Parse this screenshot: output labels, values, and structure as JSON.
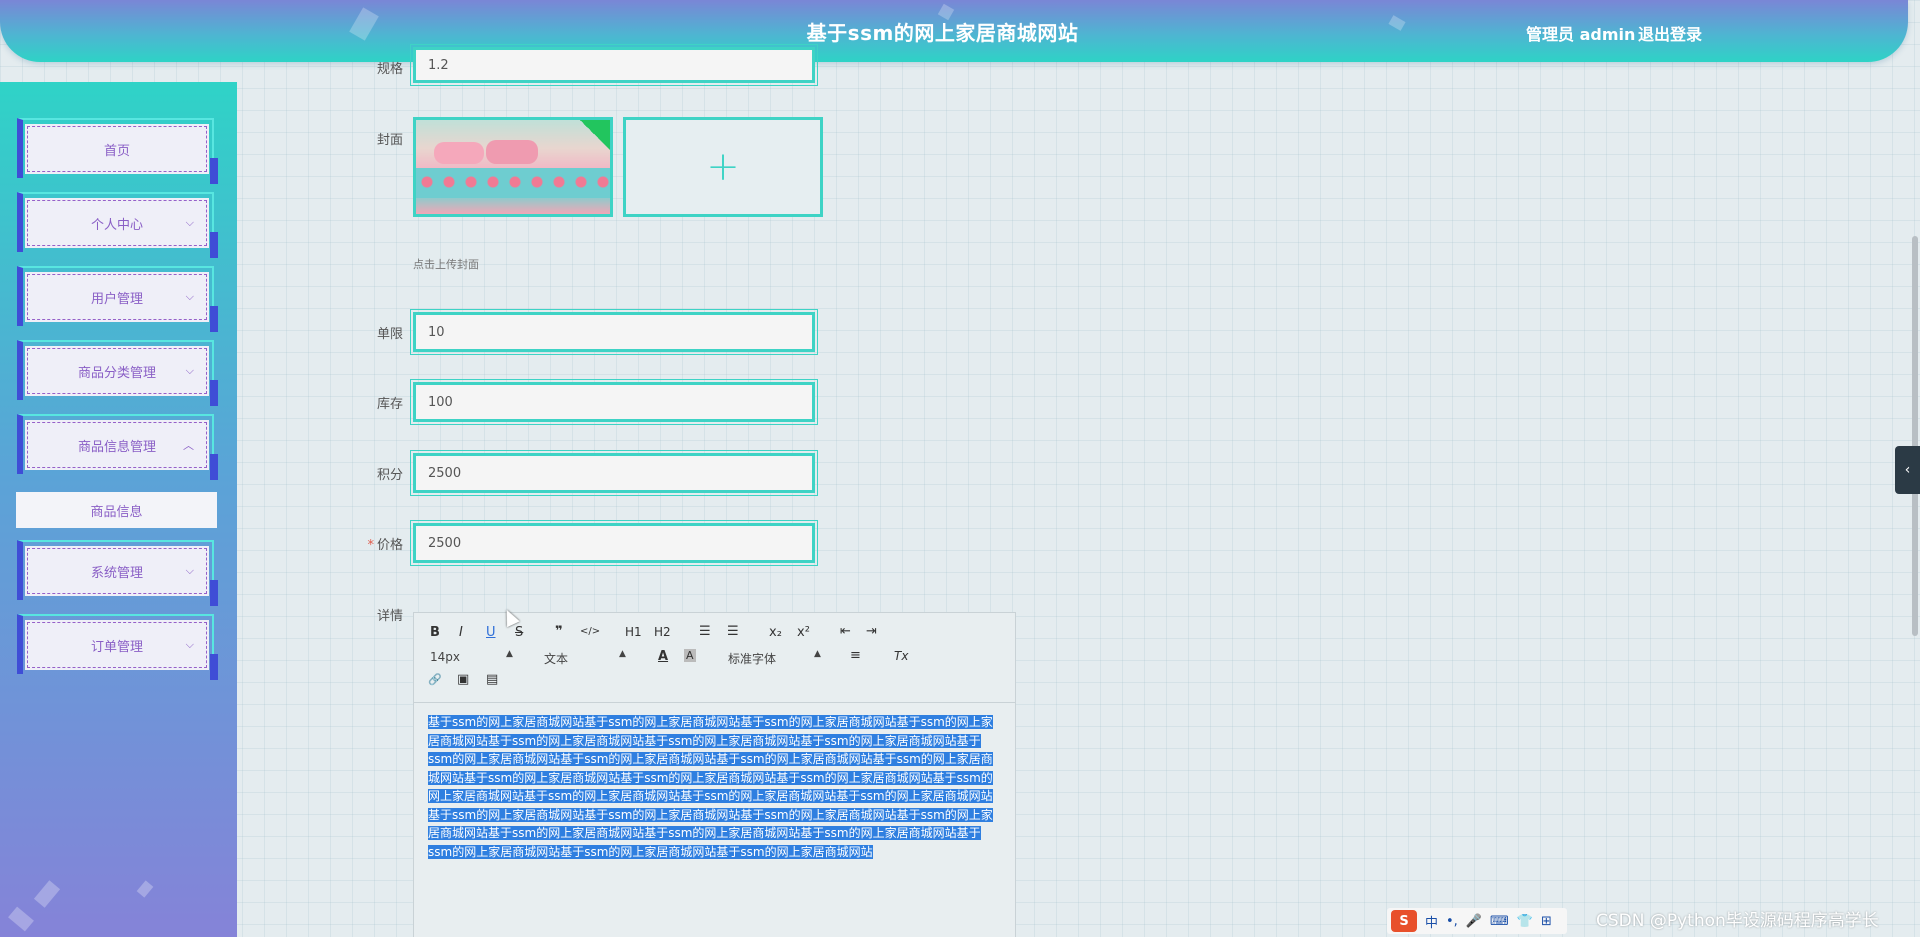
{
  "header": {
    "title": "基于ssm的网上家居商城网站",
    "user": "管理员 admin",
    "logout": "退出登录"
  },
  "sidebar": {
    "items": [
      {
        "label": "首页",
        "has_chevron": false
      },
      {
        "label": "个人中心",
        "chevron": "⌵"
      },
      {
        "label": "用户管理",
        "chevron": "⌵"
      },
      {
        "label": "商品分类管理",
        "chevron": "⌵"
      },
      {
        "label": "商品信息管理",
        "chevron": "︿"
      },
      {
        "label": "系统管理",
        "chevron": "⌵"
      },
      {
        "label": "订单管理",
        "chevron": "⌵"
      }
    ],
    "submenu": {
      "label": "商品信息"
    }
  },
  "form": {
    "spec": {
      "label": "规格",
      "value": "1.2"
    },
    "cover": {
      "label": "封面",
      "hint": "点击上传封面",
      "upload_icon": "+"
    },
    "limit": {
      "label": "单限",
      "value": "10"
    },
    "stock": {
      "label": "库存",
      "value": "100"
    },
    "points": {
      "label": "积分",
      "value": "2500"
    },
    "price": {
      "label": "价格",
      "required_mark": "*",
      "value": "2500"
    },
    "detail": {
      "label": "详情"
    }
  },
  "editor": {
    "toolbar": {
      "bold": "B",
      "italic": "I",
      "underline": "U",
      "strike": "S",
      "quote": "❞",
      "code": "</>",
      "h1": "H1",
      "h2": "H2",
      "ordered_list": "☰",
      "bullet_list": "☰",
      "subscript": "x₂",
      "superscript": "x²",
      "outdent": "⇤",
      "indent": "⇥",
      "font_size": "14px",
      "header_select": "文本",
      "color": "A",
      "background": "A",
      "font_family": "标准字体",
      "align": "≡",
      "clean": "Tx",
      "link": "🔗",
      "image": "▣",
      "video": "▤"
    },
    "content": "基于ssm的网上家居商城网站基于ssm的网上家居商城网站基于ssm的网上家居商城网站基于ssm的网上家居商城网站基于ssm的网上家居商城网站基于ssm的网上家居商城网站基于ssm的网上家居商城网站基于ssm的网上家居商城网站基于ssm的网上家居商城网站基于ssm的网上家居商城网站基于ssm的网上家居商城网站基于ssm的网上家居商城网站基于ssm的网上家居商城网站基于ssm的网上家居商城网站基于ssm的网上家居商城网站基于ssm的网上家居商城网站基于ssm的网上家居商城网站基于ssm的网上家居商城网站基于ssm的网上家居商城网站基于ssm的网上家居商城网站基于ssm的网上家居商城网站基于ssm的网上家居商城网站基于ssm的网上家居商城网站基于ssm的网上家居商城网站基于ssm的网上家居商城网站基于ssm的网上家居商城网站基于ssm的网上家居商城网站基于ssm的网上家居商城网站"
  },
  "misc": {
    "side_tab_icon": "‹",
    "ime_logo": "S",
    "ime_lang": "中",
    "watermark": "CSDN @Python毕设源码程序高学长"
  },
  "colors": {
    "accent": "#3ed3c5",
    "menu_text": "#8a5fc6",
    "selection": "#2f7fe0"
  }
}
